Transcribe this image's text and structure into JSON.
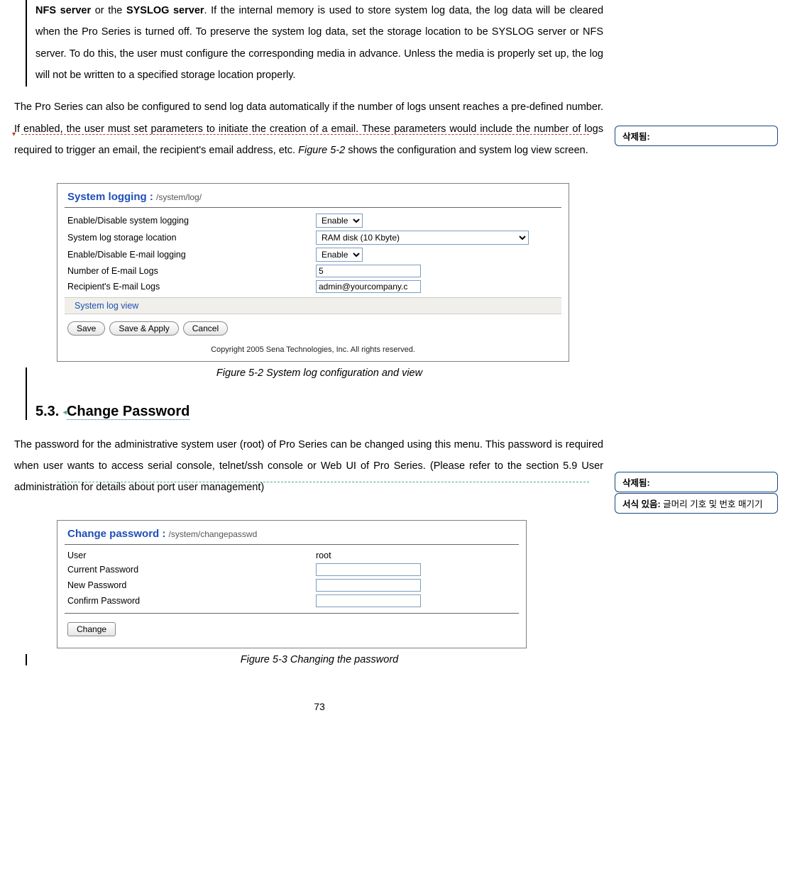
{
  "para1_part_a": "NFS server",
  "para1_part_b": " or the ",
  "para1_part_c": "SYSLOG server",
  "para1_part_d": ". If the internal memory is used to store system log data, the log data will be cleared when the Pro Series is turned off. To preserve the system log data, set the storage location to be SYSLOG server or NFS server. To do this, the user must configure the corresponding media in advance. Unless the media is properly set up, the log will not be written to a specified storage location properly.",
  "para2_a": "The Pro Series can also be configured to send log data automatically if the number of logs unsent reaches a pre-defined number. If enabled, the user must set parameters to initiate the creation of a email. These parameters would include the number of logs required to trigger an email, the recipient's email address, etc. ",
  "para2_fig": "Figure 5-2",
  "para2_b": " shows the configuration and system log view screen.",
  "fig52_caption": "Figure 5-2 System log configuration and view",
  "heading53_num": "5.3. ",
  "heading53_text": "Change Password",
  "para3": "The password for the administrative system user (root) of Pro Series can be changed using this menu. This password is required when user wants to access serial console, telnet/ssh console or Web UI of Pro Series. (Please refer to the section 5.9 User administration for details about port user management)",
  "fig53_caption": "Figure 5-3 Changing the password",
  "page_num": "73",
  "balloon1_label": "삭제됨:",
  "balloon1_text": " ",
  "balloon2_label": "삭제됨:",
  "balloon2_text": " ",
  "balloon3_label": "서식 있음:",
  "balloon3_text": " 글머리 기호 및 번호 매기기",
  "screenshot1": {
    "title_main": "System logging : ",
    "title_path": "/system/log/",
    "rows": {
      "enable_sys": "Enable/Disable system logging",
      "enable_sys_val": "Enable",
      "storage": "System log storage location",
      "storage_val": "RAM disk (10 Kbyte)",
      "enable_email": "Enable/Disable E-mail logging",
      "enable_email_val": "Enable",
      "num_logs": "Number of E-mail Logs",
      "num_logs_val": "5",
      "recipient": "Recipient's E-mail Logs",
      "recipient_val": "admin@yourcompany.c"
    },
    "subhead": "System log view",
    "btn_save": "Save",
    "btn_save_apply": "Save & Apply",
    "btn_cancel": "Cancel",
    "copyright": "Copyright 2005 Sena Technologies, Inc. All rights reserved."
  },
  "screenshot2": {
    "title_main": "Change password : ",
    "title_path": "/system/changepasswd",
    "rows": {
      "user": "User",
      "user_val": "root",
      "current": "Current Password",
      "new": "New Password",
      "confirm": "Confirm Password"
    },
    "btn_change": "Change"
  }
}
